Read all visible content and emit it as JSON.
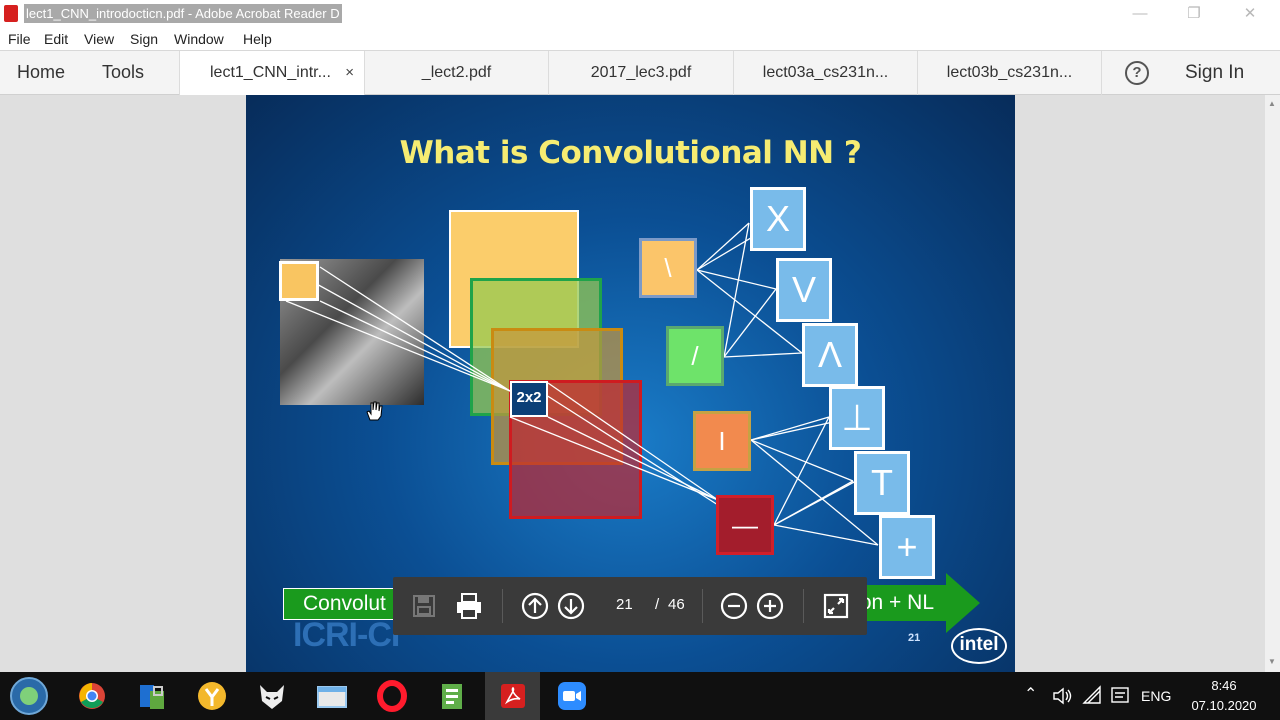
{
  "window": {
    "title": "lect1_CNN_introdocticn.pdf - Adobe Acrobat Reader D"
  },
  "menu": [
    "File",
    "Edit",
    "View",
    "Sign",
    "Window",
    "Help"
  ],
  "nav": {
    "home": "Home",
    "tools": "Tools"
  },
  "tabs": [
    {
      "label": "lect1_CNN_intr...",
      "active": true,
      "close": "×"
    },
    {
      "label": "_lect2.pdf"
    },
    {
      "label": "2017_lec3.pdf"
    },
    {
      "label": "lect03a_cs231n..."
    },
    {
      "label": "lect03b_cs231n..."
    }
  ],
  "header": {
    "help": "?",
    "sign_in": "Sign In"
  },
  "slide": {
    "title": "What is Convolutional  NN ?",
    "patch_label": "2x2",
    "filters": [
      "\\",
      "/",
      "I",
      "—"
    ],
    "outputs": [
      "X",
      "V",
      "Λ",
      "⊥",
      "T",
      "+"
    ],
    "banner_left": "Convolut",
    "banner_right": "on + NL",
    "page_number": "21",
    "logo_left": "ICRI-CI",
    "logo_right": "intel"
  },
  "floating_toolbar": {
    "current_page": "21",
    "separator": "/",
    "total_pages": "46"
  },
  "taskbar": {
    "language": "ENG",
    "time": "8:46",
    "date": "07.10.2020"
  },
  "colors": {
    "accent": "#d6201f",
    "slide_title": "#f6ec72",
    "banner_green": "#1a9a1d"
  }
}
